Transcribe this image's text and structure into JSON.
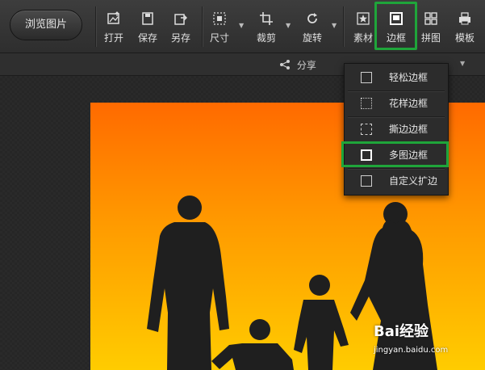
{
  "toolbar": {
    "browse_label": "浏览图片",
    "tools": [
      {
        "label": "打开",
        "icon": "open-image-icon"
      },
      {
        "label": "保存",
        "icon": "save-icon"
      },
      {
        "label": "另存",
        "icon": "save-as-icon"
      },
      {
        "label": "尺寸",
        "icon": "resize-icon"
      },
      {
        "label": "裁剪",
        "icon": "crop-icon"
      },
      {
        "label": "旋转",
        "icon": "rotate-icon"
      },
      {
        "label": "素材",
        "icon": "star-icon"
      },
      {
        "label": "边框",
        "icon": "frame-icon"
      },
      {
        "label": "拼图",
        "icon": "grid-icon"
      },
      {
        "label": "模板",
        "icon": "print-icon"
      }
    ]
  },
  "subbar": {
    "share_label": "分享"
  },
  "frame_menu": {
    "items": [
      {
        "label": "轻松边框",
        "icon": "simple-frame-icon"
      },
      {
        "label": "花样边框",
        "icon": "pattern-frame-icon"
      },
      {
        "label": "撕边边框",
        "icon": "torn-frame-icon"
      },
      {
        "label": "多图边框",
        "icon": "multi-frame-icon"
      },
      {
        "label": "自定义扩边",
        "icon": "custom-border-icon"
      }
    ]
  },
  "colors": {
    "highlight": "#1fa53a",
    "sky_top": "#ff6a00",
    "sky_bottom": "#ffcc00"
  },
  "watermark": {
    "brand": "Bai经验",
    "url": "jingyan.baidu.com"
  }
}
